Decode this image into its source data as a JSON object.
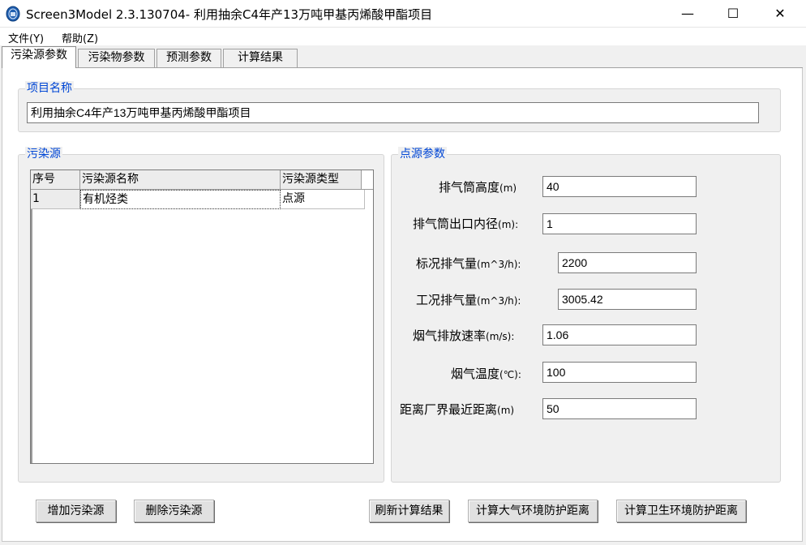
{
  "window": {
    "title": "Screen3Model 2.3.130704- 利用抽余C4年产13万吨甲基丙烯酸甲酯项目",
    "icon": "app-logo-icon",
    "controls": {
      "minimize": "—",
      "maximize": "☐",
      "close": "✕"
    }
  },
  "menu": [
    {
      "label": "文件(Y)"
    },
    {
      "label": "帮助(Z)"
    }
  ],
  "tabs": [
    {
      "label": "污染源参数",
      "active": true
    },
    {
      "label": "污染物参数",
      "active": false
    },
    {
      "label": "预测参数",
      "active": false
    },
    {
      "label": "计算结果",
      "active": false
    }
  ],
  "project": {
    "group_label": "项目名称",
    "name": "利用抽余C4年产13万吨甲基丙烯酸甲酯项目"
  },
  "sources": {
    "group_label": "污染源",
    "columns": [
      "序号",
      "污染源名称",
      "污染源类型"
    ],
    "rows": [
      {
        "id": "1",
        "name": "有机烃类",
        "type": "点源"
      }
    ]
  },
  "point_source": {
    "group_label": "点源参数",
    "params": [
      {
        "label": "排气筒高度",
        "unit": "(m)",
        "value": "40"
      },
      {
        "label": "排气筒出口内径",
        "unit": "(m):",
        "value": "1"
      },
      {
        "label": "标况排气量",
        "unit": "(m^3/h):",
        "value": "2200"
      },
      {
        "label": "工况排气量",
        "unit": "(m^3/h):",
        "value": "3005.42"
      },
      {
        "label": "烟气排放速率",
        "unit": "(m/s):",
        "value": "1.06"
      },
      {
        "label": "烟气温度",
        "unit": "(℃):",
        "value": "100"
      },
      {
        "label": "距离厂界最近距离",
        "unit": "(m)",
        "value": "50"
      }
    ]
  },
  "buttons": {
    "add_source": "增加污染源",
    "delete_source": "删除污染源",
    "refresh_results": "刷新计算结果",
    "calc_air_distance": "计算大气环境防护距离",
    "calc_health_distance": "计算卫生环境防护距离"
  },
  "colors": {
    "group_label": "#0046d5",
    "window_bg": "#f0f0f0"
  }
}
